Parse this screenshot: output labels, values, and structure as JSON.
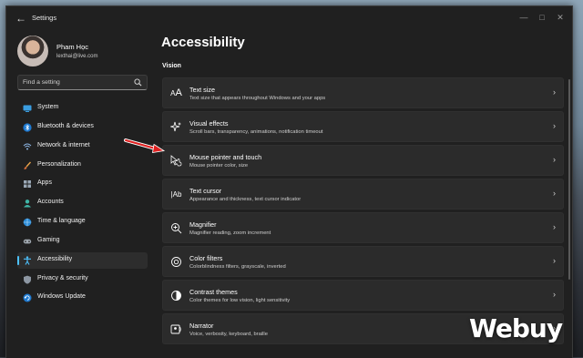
{
  "window": {
    "title": "Settings"
  },
  "profile": {
    "name": "Pham Học",
    "email": "lexthai@live.com"
  },
  "search": {
    "placeholder": "Find a setting"
  },
  "sidebar": {
    "items": [
      {
        "label": "System",
        "icon": "system-icon"
      },
      {
        "label": "Bluetooth & devices",
        "icon": "bluetooth-icon"
      },
      {
        "label": "Network & internet",
        "icon": "network-icon"
      },
      {
        "label": "Personalization",
        "icon": "brush-icon"
      },
      {
        "label": "Apps",
        "icon": "apps-icon"
      },
      {
        "label": "Accounts",
        "icon": "accounts-icon"
      },
      {
        "label": "Time & language",
        "icon": "globe-icon"
      },
      {
        "label": "Gaming",
        "icon": "gaming-icon"
      },
      {
        "label": "Accessibility",
        "icon": "accessibility-icon",
        "active": true
      },
      {
        "label": "Privacy & security",
        "icon": "shield-icon"
      },
      {
        "label": "Windows Update",
        "icon": "update-icon"
      }
    ]
  },
  "main": {
    "title": "Accessibility",
    "section": "Vision",
    "cards": [
      {
        "title": "Text size",
        "subtitle": "Text size that appears throughout Windows and your apps",
        "icon": "text-size-icon"
      },
      {
        "title": "Visual effects",
        "subtitle": "Scroll bars, transparency, animations, notification timeout",
        "icon": "visual-effects-icon"
      },
      {
        "title": "Mouse pointer and touch",
        "subtitle": "Mouse pointer color, size",
        "icon": "mouse-pointer-icon"
      },
      {
        "title": "Text cursor",
        "subtitle": "Appearance and thickness, text cursor indicator",
        "icon": "text-cursor-icon"
      },
      {
        "title": "Magnifier",
        "subtitle": "Magnifier reading, zoom increment",
        "icon": "magnifier-icon"
      },
      {
        "title": "Color filters",
        "subtitle": "Colorblindness filters, grayscale, inverted",
        "icon": "color-filters-icon"
      },
      {
        "title": "Contrast themes",
        "subtitle": "Color themes for low vision, light sensitivity",
        "icon": "contrast-icon"
      },
      {
        "title": "Narrator",
        "subtitle": "Voice, verbosity, keyboard, braille",
        "icon": "narrator-icon"
      }
    ]
  },
  "watermark": "Webuy",
  "colors": {
    "accent": "#4cc2ff",
    "window_bg": "#202020",
    "card_bg": "#2b2b2b",
    "annotation_arrow": "#e02020"
  }
}
